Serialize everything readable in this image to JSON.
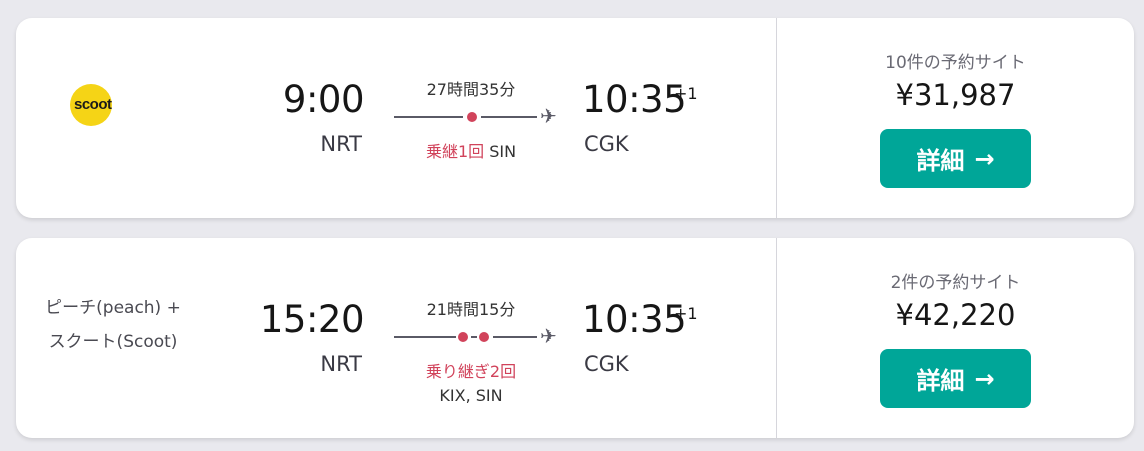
{
  "results": [
    {
      "airline_logo_text": "scoot",
      "departure_time": "9:00",
      "departure_airport": "NRT",
      "duration": "27時間35分",
      "stops_label": "乗継1回",
      "stop_airports": "SIN",
      "arrival_time": "10:35",
      "arrival_day_offset": "+1",
      "arrival_airport": "CGK",
      "sites_count": "10件の予約サイト",
      "price": "¥31,987",
      "detail_label": "詳細",
      "detail_arrow": "→"
    },
    {
      "airline_line1": "ピーチ(peach) +",
      "airline_line2": "スクート(Scoot)",
      "departure_time": "15:20",
      "departure_airport": "NRT",
      "duration": "21時間15分",
      "stops_label": "乗り継ぎ2回",
      "stop_airports": "KIX, SIN",
      "arrival_time": "10:35",
      "arrival_day_offset": "+1",
      "arrival_airport": "CGK",
      "sites_count": "2件の予約サイト",
      "price": "¥42,220",
      "detail_label": "詳細",
      "detail_arrow": "→"
    }
  ],
  "colors": {
    "accent": "#00a698",
    "stop_red": "#d1435b",
    "scoot_yellow": "#f5d416"
  }
}
